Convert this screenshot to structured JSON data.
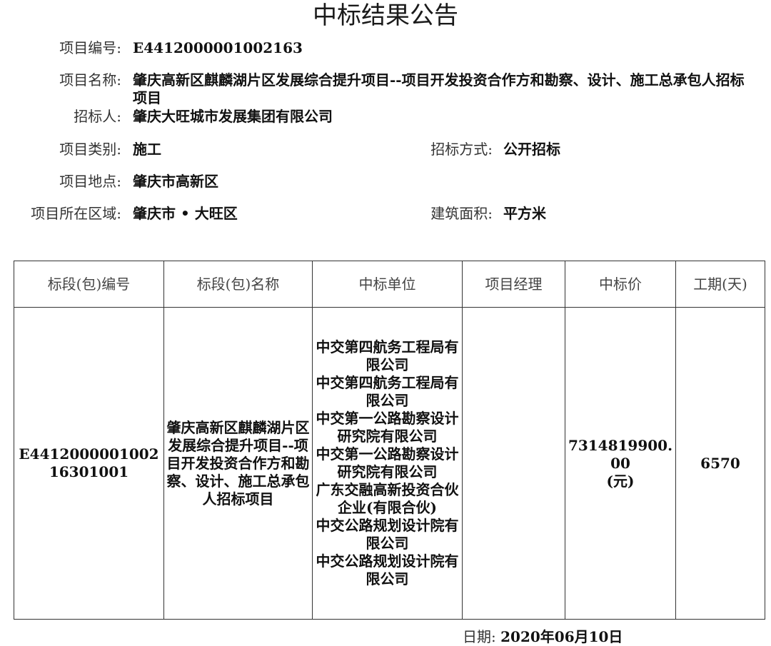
{
  "title": "中标结果公告",
  "project_code": {
    "label": "项目编号:",
    "value": "E4412000001002163"
  },
  "project_name": {
    "label": "项目名称:",
    "value": "肇庆高新区麒麟湖片区发展综合提升项目--项目开发投资合作方和勘察、设计、施工总承包人招标项目"
  },
  "tenderer": {
    "label": "招标人:",
    "value": "肇庆大旺城市发展集团有限公司"
  },
  "project_type": {
    "label": "项目类别:",
    "value": "施工"
  },
  "bidding_method": {
    "label": "招标方式:",
    "value": "公开招标"
  },
  "project_location": {
    "label": "项目地点:",
    "value": "肇庆市高新区"
  },
  "project_region": {
    "label": "项目所在区域:",
    "value": "肇庆市 • 大旺区"
  },
  "building_area": {
    "label": "建筑面积:",
    "value": "平方米"
  },
  "table": {
    "headers": [
      "标段(包)编号",
      "标段(包)名称",
      "中标单位",
      "项目经理",
      "中标价",
      "工期(天)"
    ],
    "row": {
      "section_code": "E441200000100216301001",
      "section_name": "肇庆高新区麒麟湖片区发展综合提升项目--项目开发投资合作方和勘察、设计、施工总承包人招标项目",
      "winners": [
        "中交第四航务工程局有限公司",
        "中交第四航务工程局有限公司",
        "中交第一公路勘察设计研究院有限公司",
        "中交第一公路勘察设计研究院有限公司",
        "广东交融高新投资合伙企业(有限合伙)",
        "中交公路规划设计院有限公司",
        "中交公路规划设计院有限公司"
      ],
      "project_manager": "",
      "bid_price": "7314819900.00",
      "bid_price_unit": "(元)",
      "duration_days": "6570"
    }
  },
  "date": {
    "label": "日期:",
    "value": "2020年06月10日"
  }
}
